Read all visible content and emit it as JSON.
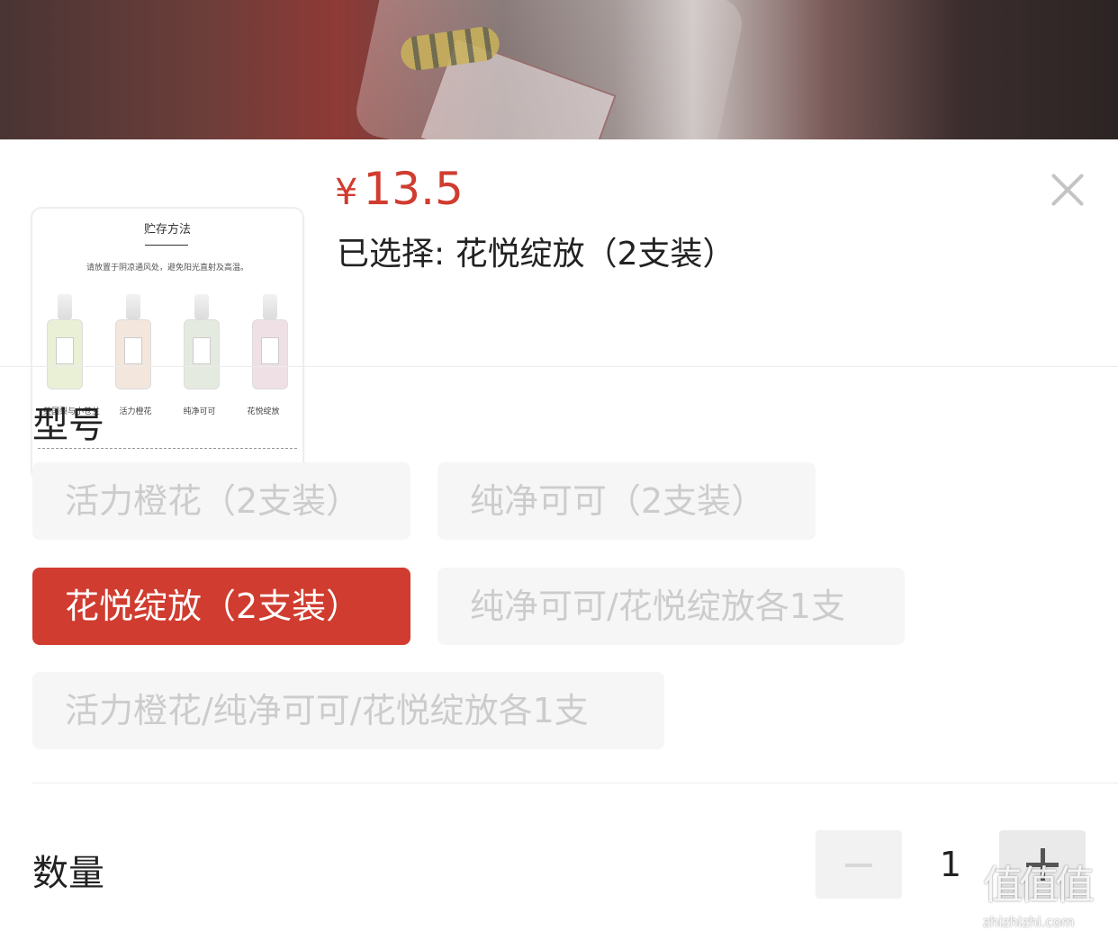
{
  "product_image": {
    "title": "贮存方法",
    "description": "请放置于阴凉通风处，避免阳光直射及高温。",
    "bottle_names": [
      "英国梨与小苍兰",
      "活力橙花",
      "纯净可可",
      "花悦绽放"
    ],
    "bottle_colors": [
      "#e9f0d6",
      "#f3e6dc",
      "#e4eadf",
      "#efe0e6"
    ]
  },
  "header": {
    "currency": "¥",
    "price": "13.5",
    "selected_text": "已选择: 花悦绽放（2支装）"
  },
  "model_section": {
    "title": "型号",
    "options": [
      {
        "label": "活力橙花（2支装）",
        "state": "disabled"
      },
      {
        "label": "纯净可可（2支装）",
        "state": "disabled"
      },
      {
        "label": "花悦绽放（2支装）",
        "state": "selected"
      },
      {
        "label": "纯净可可/花悦绽放各1支",
        "state": "disabled"
      },
      {
        "label": "活力橙花/纯净可可/花悦绽放各1支",
        "state": "disabled"
      }
    ]
  },
  "quantity_section": {
    "title": "数量",
    "value": "1"
  },
  "watermark": {
    "logo": "值值值",
    "url": "zhizhizhi.com"
  },
  "colors": {
    "accent": "#d03c2f",
    "chip_bg": "#f6f6f6",
    "chip_disabled_text": "#cccccc"
  }
}
